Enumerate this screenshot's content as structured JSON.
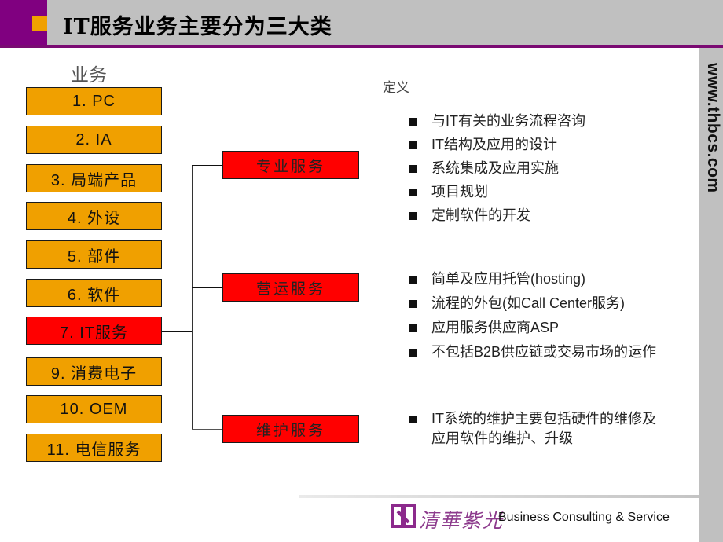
{
  "header": {
    "title": "IT服务业务主要分为三大类"
  },
  "sidebar": {
    "url": "www.thbcs.com"
  },
  "business": {
    "title": "业务",
    "items": [
      {
        "label": "1. PC",
        "active": false
      },
      {
        "label": "2. IA",
        "active": false
      },
      {
        "label": "3. 局端产品",
        "active": false
      },
      {
        "label": "4. 外设",
        "active": false
      },
      {
        "label": "5. 部件",
        "active": false
      },
      {
        "label": "6. 软件",
        "active": false
      },
      {
        "label": "7. IT服务",
        "active": true
      },
      {
        "label": "9. 消费电子",
        "active": false
      },
      {
        "label": "10. OEM",
        "active": false
      },
      {
        "label": "11. 电信服务",
        "active": false
      }
    ]
  },
  "services": [
    {
      "label": "专业服务",
      "bullets": [
        "与IT有关的业务流程咨询",
        "IT结构及应用的设计",
        "系统集成及应用实施",
        "项目规划",
        "定制软件的开发"
      ]
    },
    {
      "label": "营运服务",
      "bullets": [
        "简单及应用托管(hosting)",
        "流程的外包(如Call  Center服务)",
        "应用服务供应商ASP",
        "不包括B2B供应链或交易市场的运作"
      ]
    },
    {
      "label": "维护服务",
      "bullets": [
        "IT系统的维护主要包括硬件的维修及应用软件的维护、升级"
      ]
    }
  ],
  "definition": {
    "label": "定义"
  },
  "colors": {
    "purple": "#800080",
    "orange": "#f0a000",
    "red": "#ff0000",
    "gray": "#c0c0c0"
  },
  "footer": {
    "logo_text": "清華紫光",
    "tagline": "Business Consulting & Service"
  }
}
